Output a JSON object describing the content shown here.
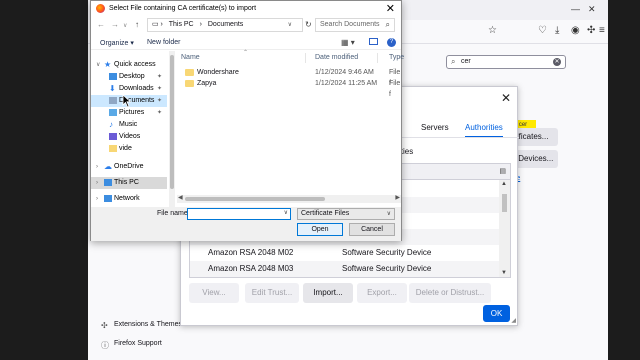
{
  "firefox": {
    "search_value": "cer",
    "sidebar_links": [
      "Extensions & Themes",
      "Firefox Support"
    ]
  },
  "cert_manager": {
    "tabs": [
      "Servers",
      "Authorities"
    ],
    "active_tab": "Authorities",
    "caption_fragment": "ities",
    "visible_type_fragments": [
      "en",
      "en",
      "en",
      "en",
      "en"
    ],
    "rows": [
      {
        "name": "Amazon RSA 2048 M02",
        "device": "Software Security Device"
      },
      {
        "name": "Amazon RSA 2048 M03",
        "device": "Software Security Device"
      }
    ],
    "buttons": {
      "view": "View...",
      "edit_trust": "Edit Trust...",
      "import": "Import...",
      "export": "Export...",
      "delete": "Delete or Distrust..."
    },
    "ok": "OK",
    "side": {
      "tag": "cer",
      "certificates_btn": "rtificates...",
      "devices_btn": "y Devices...",
      "link": "re"
    }
  },
  "file_dialog": {
    "title": "Select File containing CA certificate(s) to import",
    "path": [
      "This PC",
      "Documents"
    ],
    "search_placeholder": "Search Documents",
    "organize": "Organize",
    "new_folder": "New folder",
    "tree": [
      {
        "label": "Quick access",
        "icon": "star-icon"
      },
      {
        "label": "Desktop",
        "icon": "desktop-icon",
        "pinned": true
      },
      {
        "label": "Downloads",
        "icon": "download-icon",
        "pinned": true
      },
      {
        "label": "Documents",
        "icon": "documents-icon",
        "pinned": true,
        "selected": true
      },
      {
        "label": "Pictures",
        "icon": "pictures-icon",
        "pinned": true
      },
      {
        "label": "Music",
        "icon": "music-icon"
      },
      {
        "label": "Videos",
        "icon": "videos-icon"
      },
      {
        "label": "vide",
        "icon": "folder-icon"
      },
      {
        "label": "OneDrive",
        "icon": "cloud-icon"
      },
      {
        "label": "This PC",
        "icon": "computer-icon",
        "selected_group": true
      },
      {
        "label": "Network",
        "icon": "network-icon"
      }
    ],
    "columns": {
      "name": "Name",
      "date": "Date modified",
      "type": "Type"
    },
    "files": [
      {
        "name": "Wondershare",
        "date": "1/12/2024 9:46 AM",
        "type": "File f"
      },
      {
        "name": "Zapya",
        "date": "1/12/2024 11:25 AM",
        "type": "File f"
      }
    ],
    "file_name_label": "File name:",
    "file_name_value": "",
    "filter": "Certificate Files",
    "open": "Open",
    "cancel": "Cancel"
  }
}
